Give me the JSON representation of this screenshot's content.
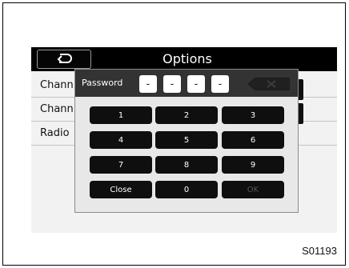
{
  "options": {
    "title": "Options",
    "rows": [
      {
        "label": "Chann"
      },
      {
        "label": "Chann"
      },
      {
        "label": "Radio"
      }
    ]
  },
  "password_dialog": {
    "label": "Password",
    "digits": [
      "-",
      "-",
      "-",
      "-"
    ],
    "keys": [
      "1",
      "2",
      "3",
      "4",
      "5",
      "6",
      "7",
      "8",
      "9",
      "Close",
      "0",
      "OK"
    ]
  },
  "figure_code": "S01193",
  "icons": {
    "back": "back-arrow-icon",
    "backspace": "backspace-icon"
  }
}
